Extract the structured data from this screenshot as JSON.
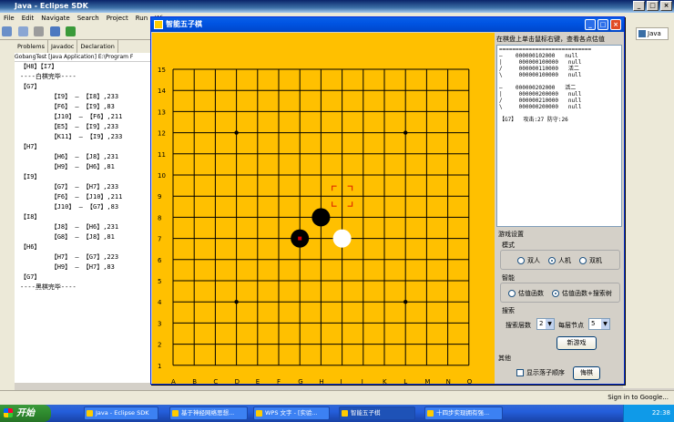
{
  "eclipse": {
    "title": "Java - Eclipse SDK",
    "menu": [
      "File",
      "Edit",
      "Navigate",
      "Search",
      "Project",
      "Run",
      "Wi"
    ],
    "tabs": [
      "Problems",
      "Javadoc",
      "Declaration"
    ],
    "console_header": "GobangTest [Java Application] E:\\Program F",
    "console_lines": [
      "【H8】【I7】",
      "----白棋完毕----",
      "【G7】",
      "        【I9】 — 【I8】,233",
      "        【F6】 — 【I9】,83",
      "        【J10】 — 【F6】,211",
      "        【E5】 — 【I9】,233",
      "        【K11】 — 【I9】,233",
      "【H7】",
      "        【H6】 — 【J8】,231",
      "        【H9】 — 【H6】,81",
      "【I9】",
      "        【G7】 — 【H7】,233",
      "        【F6】 — 【J10】,211",
      "        【J10】 — 【G7】,83",
      "【I8】",
      "        【J8】 — 【H6】,231",
      "        【G8】 — 【J8】,81",
      "【H6】",
      "        【H7】 — 【G7】,223",
      "        【H9】 — 【H7】,83",
      "【G7】",
      "----黑棋完毕----"
    ],
    "perspective": "Java",
    "status_right": "Sign in to Google..."
  },
  "gomoku": {
    "title": "智能五子棋",
    "row_labels": [
      "15",
      "14",
      "13",
      "12",
      "11",
      "10",
      "9",
      "8",
      "7",
      "6",
      "5",
      "4",
      "3",
      "2",
      "1"
    ],
    "col_labels": [
      "A",
      "B",
      "C",
      "D",
      "E",
      "F",
      "G",
      "H",
      "I",
      "J",
      "K",
      "L",
      "M",
      "N",
      "O"
    ],
    "star_points": [
      [
        "D",
        12
      ],
      [
        "L",
        12
      ],
      [
        "D",
        4
      ],
      [
        "L",
        4
      ]
    ],
    "stones": [
      {
        "col": "H",
        "row": 8,
        "color": "black",
        "last": false
      },
      {
        "col": "G",
        "row": 7,
        "color": "black",
        "last": true
      },
      {
        "col": "I",
        "row": 7,
        "color": "white",
        "last": false
      }
    ],
    "cursor": {
      "col": "I",
      "row": 9
    },
    "panel": {
      "hint": "在棋盘上单击鼠标右键，查看各点估值",
      "info_lines": [
        "============================",
        "—    000000102000   null",
        "|     000000100000   null",
        "/     000000110000   活二",
        "\\     000000100000   null",
        "",
        "—    000000202000   活二",
        "|     000000200000   null",
        "/     000000210000   null",
        "\\     000000200000   null",
        "",
        "【G7】  攻击:27 防守:26"
      ],
      "game_settings": "游戏设置",
      "mode_label": "模式",
      "modes": [
        {
          "label": "双人",
          "selected": false
        },
        {
          "label": "人机",
          "selected": true
        },
        {
          "label": "双机",
          "selected": false
        }
      ],
      "ai_label": "智能",
      "ai_options": [
        {
          "label": "估值函数",
          "selected": false
        },
        {
          "label": "估值函数+搜索树",
          "selected": true
        }
      ],
      "search_label": "搜索",
      "depth_label": "搜索层数",
      "depth_value": "2",
      "nodes_label": "每层节点",
      "nodes_value": "5",
      "new_game": "新游戏",
      "other_label": "其他",
      "show_order": "显示落子顺序",
      "undo": "悔棋"
    }
  },
  "taskbar": {
    "start": "开始",
    "tasks": [
      "Java - Eclipse SDK",
      "基于神经网络思想...",
      "WPS 文字 - [实验...",
      "智能五子棋",
      "十四步实现拥有强..."
    ],
    "clock": "22:38"
  }
}
